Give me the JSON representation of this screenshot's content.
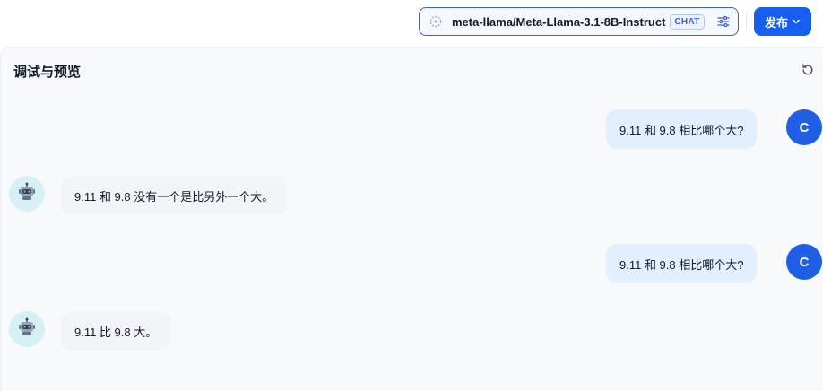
{
  "header": {
    "model_name": "meta-llama/Meta-Llama-3.1-8B-Instruct",
    "model_mode_badge": "CHAT",
    "publish_label": "发布",
    "colors": {
      "accent": "#155eef",
      "selector_border": "#3f5fd6"
    },
    "icons": {
      "model": "model-provider-icon",
      "settings": "sliders-icon",
      "publish_chevron": "chevron-down-icon"
    }
  },
  "panel": {
    "title": "调试与预览",
    "reset_icon": "refresh-icon"
  },
  "messages": [
    {
      "role": "user",
      "avatar_letter": "C",
      "text": "9.11 和 9.8 相比哪个大?"
    },
    {
      "role": "assistant",
      "avatar_icon": "robot-icon",
      "text": "9.11 和 9.8 没有一个是比另外一个大。"
    },
    {
      "role": "user",
      "avatar_letter": "C",
      "text": "9.11 和 9.8 相比哪个大?"
    },
    {
      "role": "assistant",
      "avatar_icon": "robot-icon",
      "text": "9.11 比 9.8 大。"
    }
  ]
}
